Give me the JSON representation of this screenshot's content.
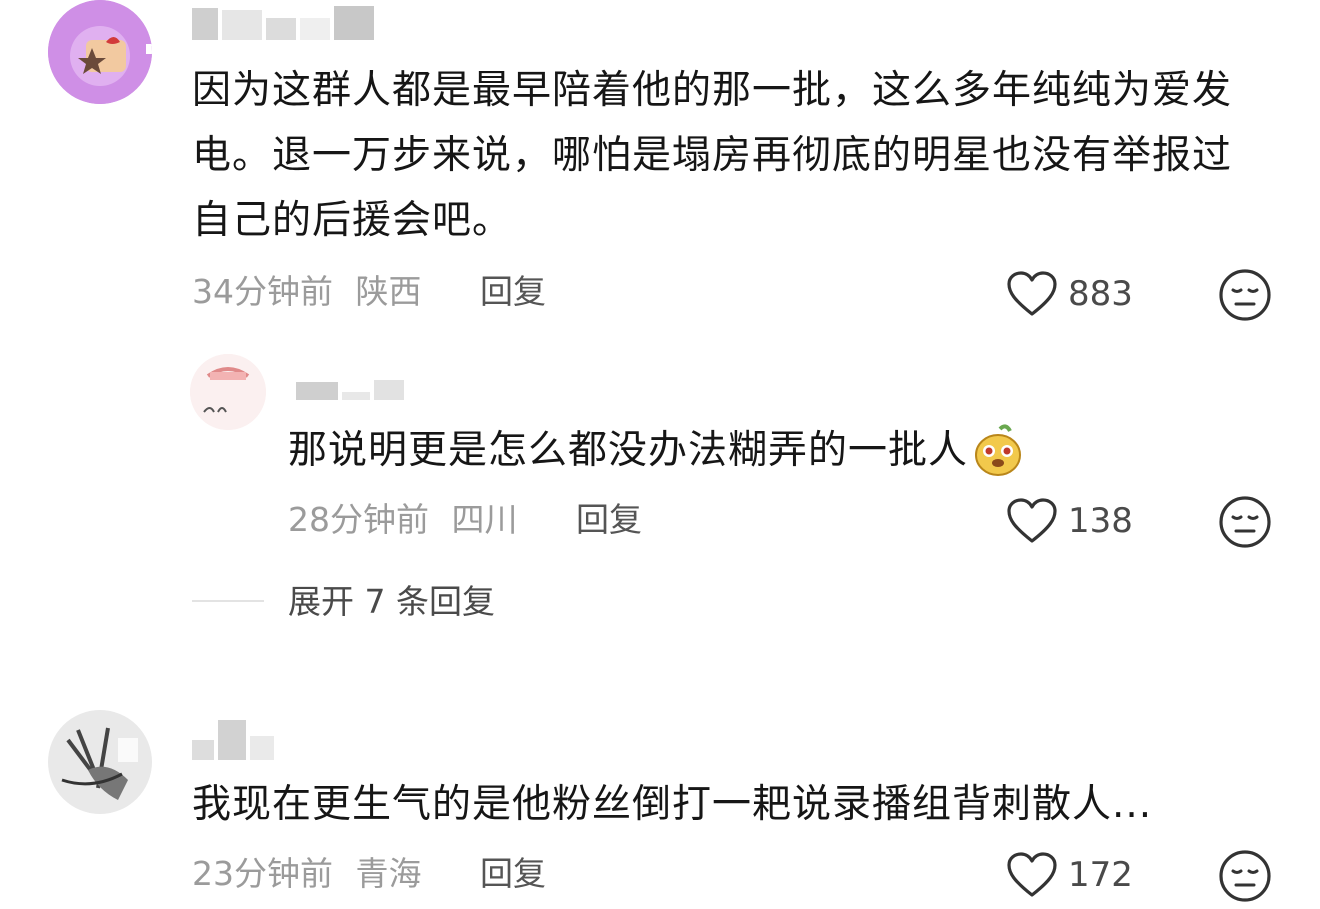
{
  "comments": [
    {
      "text": "因为这群人都是最早陪着他的那一批，这么多年纯纯为爱发电。退一万步来说，哪怕是塌房再彻底的明星也没有举报过自己的后援会吧。",
      "time": "34分钟前",
      "region": "陕西",
      "reply_label": "回复",
      "likes": "883"
    },
    {
      "text": "那说明更是怎么都没办法糊弄的一批人",
      "time": "28分钟前",
      "region": "四川",
      "reply_label": "回复",
      "likes": "138"
    },
    {
      "text": "我现在更生气的是他粉丝倒打一耙说录播组背刺散人...",
      "time": "23分钟前",
      "region": "青海",
      "reply_label": "回复",
      "likes": "172"
    }
  ],
  "expand_label": "展开 7 条回复",
  "icons": {
    "like": "heart-outline-icon",
    "dislike": "neutral-face-icon",
    "emoji": "cute-creature-emoji"
  },
  "colors": {
    "text": "#161616",
    "meta": "#9b9b9b",
    "avatar1": "#c98ae0"
  }
}
